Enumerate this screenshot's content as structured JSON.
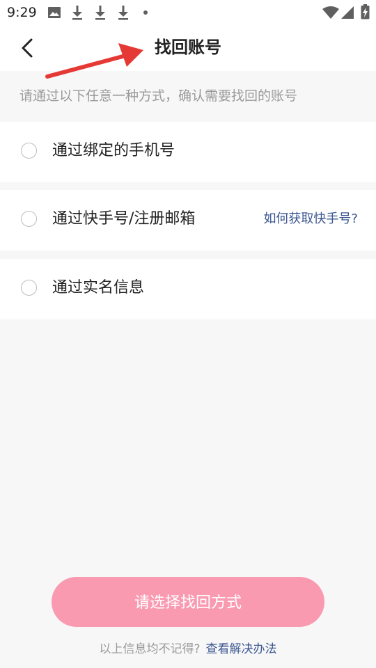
{
  "status_bar": {
    "time": "9:29",
    "icons": [
      "image-icon",
      "download-icon",
      "download-icon",
      "download-icon",
      "dot-icon",
      "wifi-icon",
      "signal-icon",
      "battery-charging-icon"
    ]
  },
  "header": {
    "title": "找回账号",
    "back_icon": "chevron-left-icon"
  },
  "hint": "请通过以下任意一种方式，确认需要找回的账号",
  "options": [
    {
      "label": "通过绑定的手机号"
    },
    {
      "label": "通过快手号/注册邮箱",
      "link": "如何获取快手号?"
    },
    {
      "label": "通过实名信息"
    }
  ],
  "submit": {
    "label": "请选择找回方式",
    "color": "#f99ab1"
  },
  "footer": {
    "text": "以上信息均不记得?",
    "link": "查看解决办法"
  },
  "colors": {
    "link": "#3b5691",
    "annotation_arrow": "#e53935"
  }
}
